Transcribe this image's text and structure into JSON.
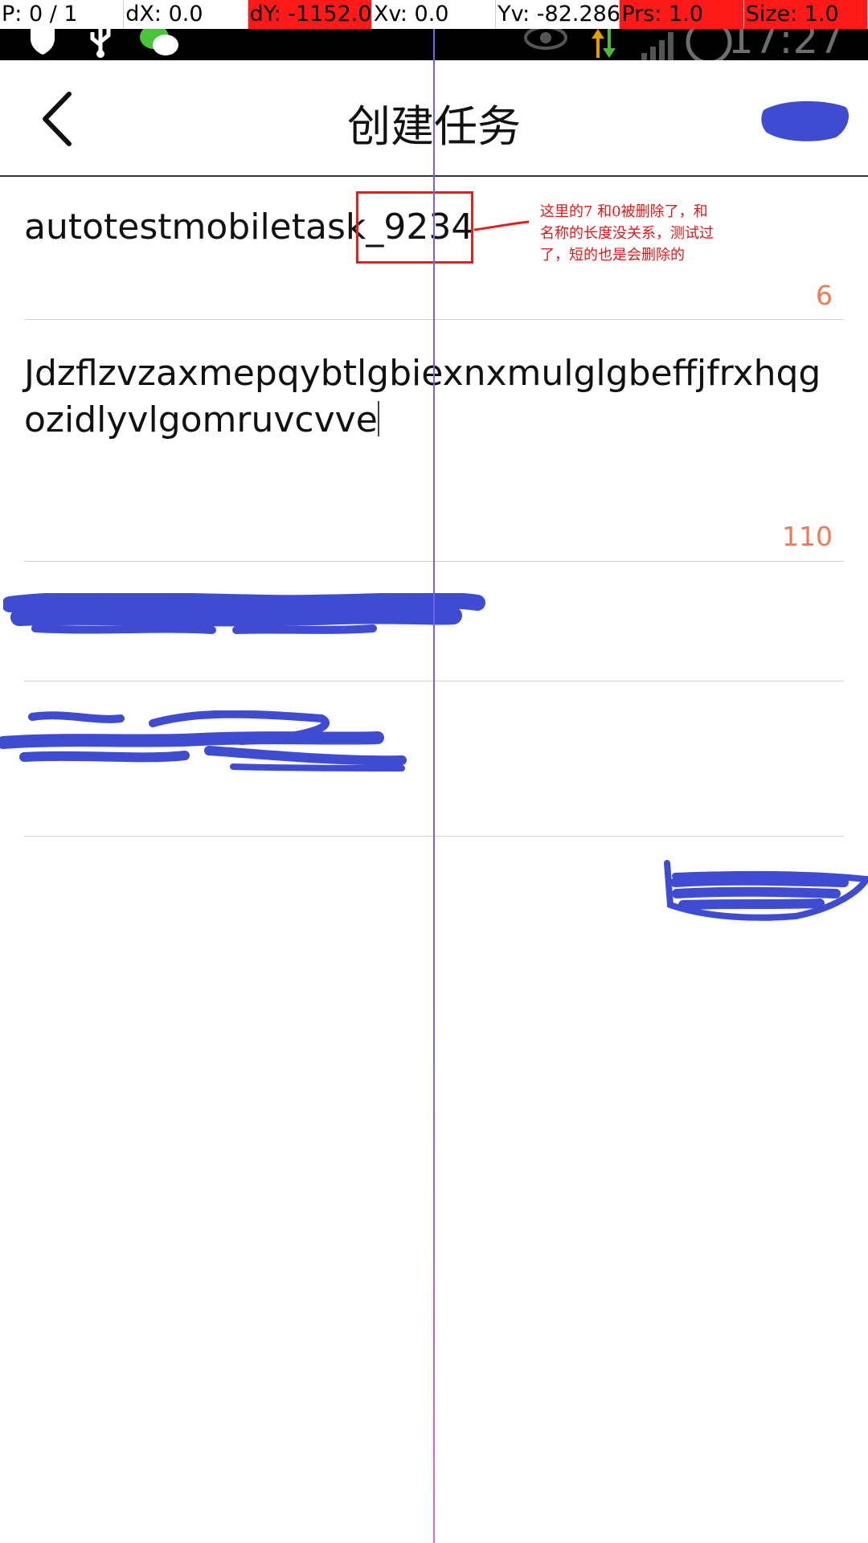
{
  "debug_bar": {
    "cells": [
      {
        "text": "P: 0 / 1",
        "alert": false
      },
      {
        "text": "dX: 0.0",
        "alert": false
      },
      {
        "text": "dY: -1152.0",
        "alert": true
      },
      {
        "text": "Xv: 0.0",
        "alert": false
      },
      {
        "text": "Yv: -82.286",
        "alert": false
      },
      {
        "text": "Prs: 1.0",
        "alert": true
      },
      {
        "text": "Size: 1.0",
        "alert": true
      }
    ]
  },
  "status_bar": {
    "time": "17:27",
    "icons": [
      "shield-icon",
      "usb-icon",
      "wechat-icon",
      "eye-icon",
      "data-transfer-icon",
      "signal-icon",
      "battery-icon"
    ]
  },
  "header": {
    "title": "创建任务",
    "back_icon": "chevron-left-icon"
  },
  "form": {
    "task_name": {
      "value": "autotestmobiletask_9234",
      "remaining_count": "6"
    },
    "description": {
      "value": "Jdzflzvzaxmepqybtlgbiexnxmulglgbeffjfrxhqgozidlyvlgomruvcvve",
      "remaining_count": "110"
    }
  },
  "annotation": {
    "note": "这里的7  和0被删除了，和名称的长度没关系，测试过了，短的也是会删除的"
  },
  "colors": {
    "counter": "#ef7a58",
    "annotation_red": "#e01818",
    "redaction_blue": "#3f4bd0",
    "debug_alert": "#ff1a1a"
  }
}
